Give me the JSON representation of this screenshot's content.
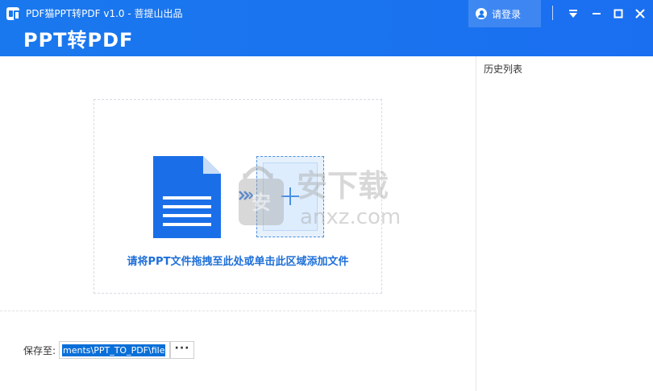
{
  "titlebar": {
    "title": "PDF猫PPT转PDF v1.0 - 菩提山出品"
  },
  "header": {
    "title": "PPT转PDF",
    "login_label": "请登录"
  },
  "history": {
    "title": "历史列表"
  },
  "dropzone": {
    "hint": "请将PPT文件拖拽至此处或单击此区域添加文件"
  },
  "save": {
    "label": "保存至:",
    "path_value": "ments\\PPT_TO_PDF\\file",
    "browse_label": "···"
  },
  "watermark": {
    "text": "安下载",
    "sub": "anxz.com"
  },
  "colors": {
    "brand": "#1a78ee",
    "doc_blue": "#1a6fe8",
    "hint_blue": "#1e6fd8",
    "selection": "#0a6fd8"
  }
}
